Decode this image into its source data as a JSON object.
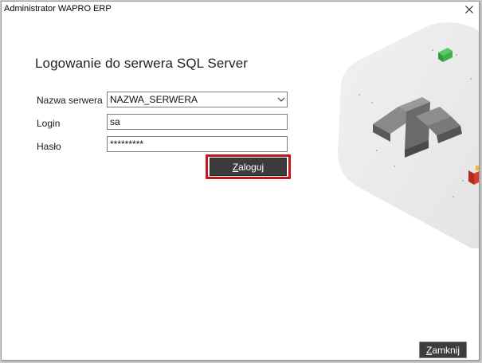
{
  "window": {
    "title": "Administrator WAPRO ERP"
  },
  "form": {
    "heading": "Logowanie do serwera SQL Server",
    "server_label": "Nazwa serwera",
    "server_value": "NAZWA_SERWERA",
    "login_label": "Login",
    "login_value": "sa",
    "password_label": "Hasło",
    "password_value": "*********"
  },
  "buttons": {
    "login_first": "Z",
    "login_rest": "aloguj",
    "close_first": "Z",
    "close_rest": "amknij"
  },
  "icons": {
    "close": "close-icon",
    "dropdown": "chevron-down-icon",
    "logo": "wapro-w-logo-icon"
  },
  "colors": {
    "button_bg": "#3c3c3c",
    "focus_highlight": "#c4161c",
    "logo_green": "#3db04a",
    "logo_red": "#d63a2f",
    "logo_yellow": "#f2b731"
  }
}
